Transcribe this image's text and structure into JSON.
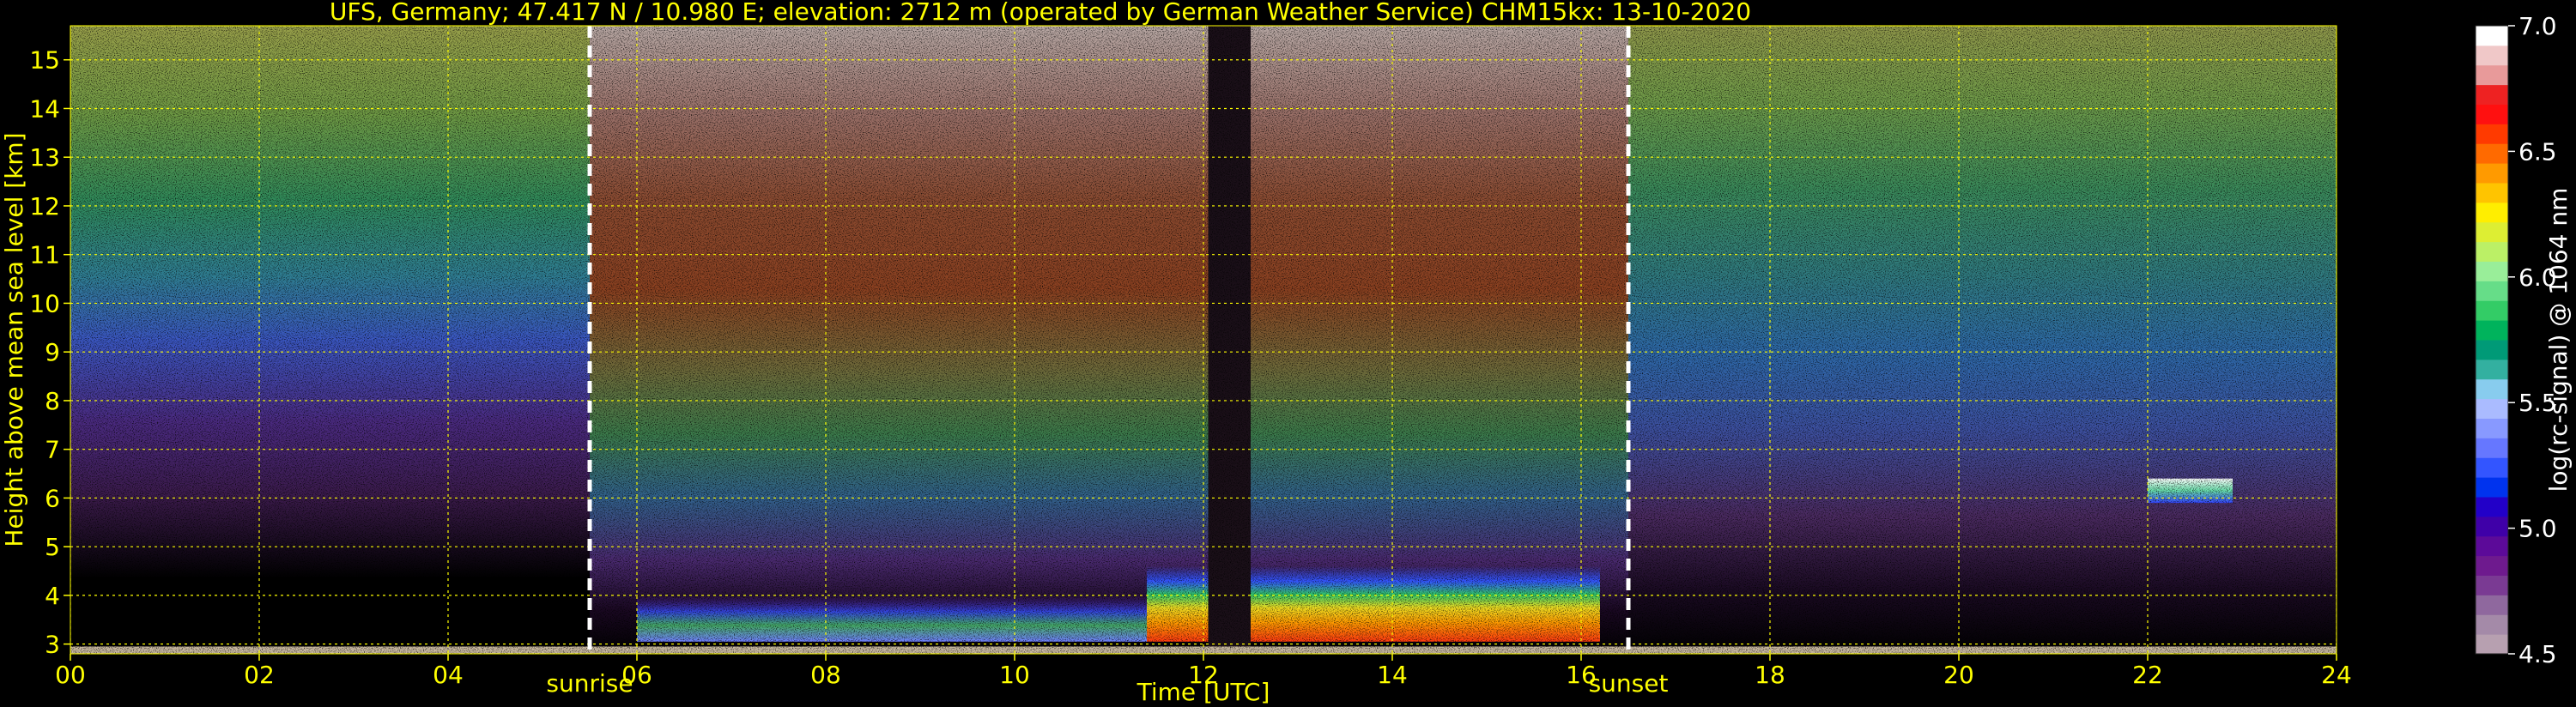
{
  "chart_data": {
    "type": "heatmap",
    "title": "UFS, Germany; 47.417 N / 10.980 E; elevation: 2712 m  (operated by German Weather Service)    CHM15kx: 13-10-2020",
    "xlabel": "Time [UTC]",
    "ylabel": "Height above mean sea level [km]",
    "xlim": [
      0,
      24
    ],
    "ylim": [
      2.8,
      15.7
    ],
    "x_ticks": [
      "00",
      "02",
      "04",
      "06",
      "08",
      "10",
      "12",
      "14",
      "16",
      "18",
      "20",
      "22",
      "24"
    ],
    "y_ticks": [
      "3",
      "4",
      "5",
      "6",
      "7",
      "8",
      "9",
      "10",
      "11",
      "12",
      "13",
      "14",
      "15"
    ],
    "grid": true,
    "annotations": [
      {
        "label": "sunrise",
        "x": 5.5
      },
      {
        "label": "sunset",
        "x": 16.5
      }
    ],
    "colorbar": {
      "label": "log(rc-signal) @ 1064 nm",
      "range": [
        4.5,
        7.0
      ],
      "ticks": [
        "4.5",
        "5.0",
        "5.5",
        "6.0",
        "6.5",
        "7.0"
      ],
      "colors": [
        "#b7a0b0",
        "#a48aa8",
        "#8f689e",
        "#7a3a93",
        "#6e1a8e",
        "#5c0a99",
        "#3f00a8",
        "#2200c8",
        "#0033ee",
        "#3355ff",
        "#6677ff",
        "#8899ff",
        "#aabbff",
        "#88ccee",
        "#33b0a0",
        "#009a77",
        "#00b35c",
        "#33cc66",
        "#66dd88",
        "#99ee99",
        "#bbf066",
        "#ddee33",
        "#ffee00",
        "#ffc400",
        "#ff9a00",
        "#ff6a00",
        "#ff3a00",
        "#ff1010",
        "#ee2222",
        "#e89a9a",
        "#f0c8c8",
        "#ffffff"
      ]
    },
    "layers": [
      {
        "from": 6.0,
        "to": 11.4,
        "top_km": 4.0,
        "value": 5.9
      },
      {
        "from": 11.4,
        "to": 12.05,
        "top_km": 4.6,
        "value": 6.5
      },
      {
        "from": 12.5,
        "to": 16.2,
        "top_km": 4.6,
        "value": 6.7
      },
      {
        "from": 22.0,
        "to": 22.9,
        "top_km": 6.4,
        "value": 5.9
      }
    ]
  }
}
